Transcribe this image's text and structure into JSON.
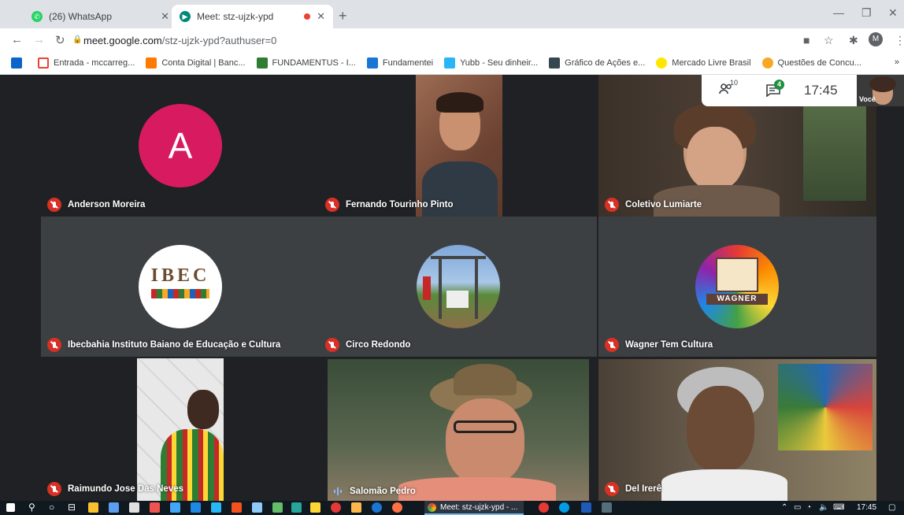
{
  "browser": {
    "tabs": [
      {
        "title": "(26) WhatsApp",
        "active": false
      },
      {
        "title": "Meet: stz-ujzk-ypd",
        "active": true
      }
    ],
    "address": {
      "domain": "meet.google.com",
      "path": "/stz-ujzk-ypd?authuser=0"
    },
    "profile_initial": "M",
    "bookmarks": [
      "Entrada - mccarreg...",
      "Conta Digital | Banc...",
      "FUNDAMENTUS - I...",
      "Fundamentei",
      "Yubb - Seu dinheir...",
      "Gráfico de Ações e...",
      "Mercado Livre Brasil",
      "Questões de Concu..."
    ],
    "more_bookmarks": "»"
  },
  "meet": {
    "participant_count": "10",
    "chat_badge": "4",
    "time": "17:45",
    "self_label": "Você",
    "participants": [
      {
        "name": "Anderson Moreira",
        "avatar_letter": "A"
      },
      {
        "name": "Fernando Tourinho Pinto"
      },
      {
        "name": "Coletivo Lumiarte"
      },
      {
        "name": "Ibecbahia Instituto Baiano de Educação e Cultura",
        "logo_text": "IBEC"
      },
      {
        "name": "Circo Redondo"
      },
      {
        "name": "Wagner Tem Cultura",
        "logo_text": "WAGNER"
      },
      {
        "name": "Raimundo Jose Das Neves"
      },
      {
        "name": "Salomão Pedro"
      },
      {
        "name": "Del Irerê"
      }
    ]
  },
  "taskbar": {
    "active_window": "Meet: stz-ujzk-ypd - ...",
    "clock": "17:45"
  },
  "colors": {
    "meet_bg": "#202124",
    "muted_red": "#d93025",
    "avatar_pink": "#d81b60",
    "chat_green": "#1e8e3e"
  }
}
